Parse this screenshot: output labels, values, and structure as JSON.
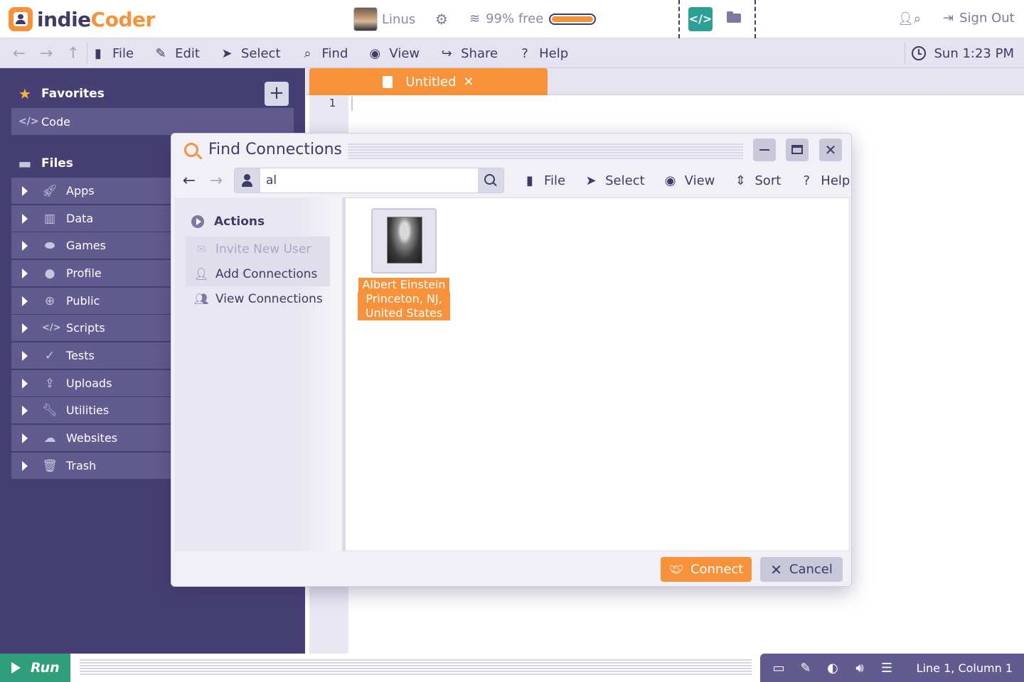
{
  "app": {
    "logo_part1": "indie",
    "logo_part2": "Coder"
  },
  "header": {
    "user_name": "Linus",
    "storage_text": "99% free",
    "storage_free_fraction": 0.99,
    "sign_out": "Sign Out"
  },
  "menubar": {
    "items": [
      {
        "label": "File",
        "icon": "file-icon"
      },
      {
        "label": "Edit",
        "icon": "pencil-icon"
      },
      {
        "label": "Select",
        "icon": "cursor-icon"
      },
      {
        "label": "Find",
        "icon": "search-icon"
      },
      {
        "label": "View",
        "icon": "eye-icon"
      },
      {
        "label": "Share",
        "icon": "share-icon"
      },
      {
        "label": "Help",
        "icon": "help-icon"
      }
    ],
    "clock": "Sun 1:23 PM"
  },
  "sidebar": {
    "favorites_label": "Favorites",
    "favorite_item": "Code",
    "files_label": "Files",
    "folders": [
      {
        "label": "Apps",
        "icon": "rocket-icon"
      },
      {
        "label": "Data",
        "icon": "chart-icon"
      },
      {
        "label": "Games",
        "icon": "gamepad-icon"
      },
      {
        "label": "Profile",
        "icon": "user-icon"
      },
      {
        "label": "Public",
        "icon": "globe-icon"
      },
      {
        "label": "Scripts",
        "icon": "code-icon"
      },
      {
        "label": "Tests",
        "icon": "check-icon"
      },
      {
        "label": "Uploads",
        "icon": "upload-icon"
      },
      {
        "label": "Utilities",
        "icon": "wrench-icon"
      },
      {
        "label": "Websites",
        "icon": "cloud-icon"
      },
      {
        "label": "Trash",
        "icon": "trash-icon"
      }
    ]
  },
  "editor": {
    "tab_title": "Untitled",
    "line_number": "1"
  },
  "dialog": {
    "title": "Find Connections",
    "search_value": "al",
    "menu": [
      {
        "label": "File",
        "icon": "file-icon"
      },
      {
        "label": "Select",
        "icon": "cursor-icon"
      },
      {
        "label": "View",
        "icon": "eye-icon"
      },
      {
        "label": "Sort",
        "icon": "sort-icon"
      },
      {
        "label": "Help",
        "icon": "help-icon"
      }
    ],
    "actions_label": "Actions",
    "actions": [
      {
        "label": "Invite New User",
        "icon": "envelope-icon",
        "disabled": true
      },
      {
        "label": "Add Connections",
        "icon": "user-plus-icon",
        "disabled": false
      },
      {
        "label": "View Connections",
        "icon": "users-icon",
        "disabled": false
      }
    ],
    "results": [
      {
        "name": "Albert Einstein",
        "location": "Princeton, NJ, United States"
      }
    ],
    "connect_label": "Connect",
    "cancel_label": "Cancel"
  },
  "statusbar": {
    "run_label": "Run",
    "position": "Line 1, Column 1"
  },
  "colors": {
    "brand_orange": "#f7923a",
    "sidebar_purple": "#463f73",
    "item_purple": "#625b8f",
    "run_green": "#2e9f7a",
    "teal": "#2d9f94"
  }
}
